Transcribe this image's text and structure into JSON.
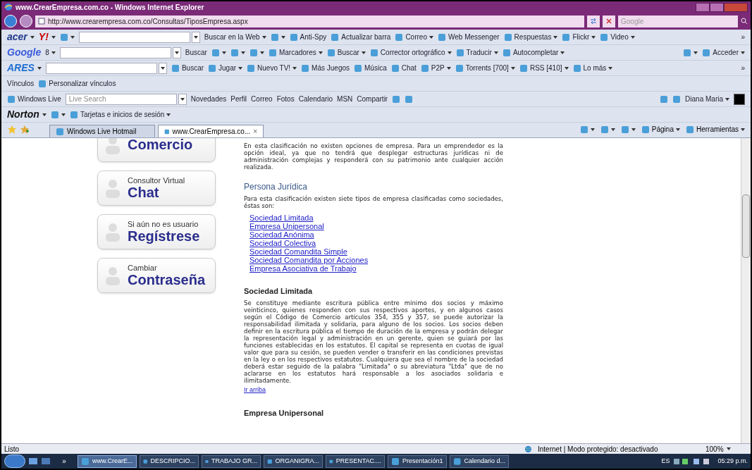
{
  "window": {
    "title": "www.CrearEmpresa.com.co - Windows Internet Explorer"
  },
  "address_bar": {
    "url": "http://www.crearempresa.com.co/Consultas/TiposEmpresa.aspx"
  },
  "search": {
    "placeholder": "Google"
  },
  "toolbars": [
    {
      "items": [
        {
          "kind": "logo",
          "label": "acer",
          "color": "#1f3a8a",
          "caret": true
        },
        {
          "kind": "logo",
          "label": "Y!",
          "color": "#cc0000",
          "caret": true
        },
        {
          "kind": "button",
          "icon": true,
          "caret": true
        },
        {
          "kind": "field",
          "caret": true
        },
        {
          "kind": "button",
          "label": "Buscar en la Web",
          "caret": true
        },
        {
          "kind": "button",
          "icon": true,
          "caret": true
        },
        {
          "kind": "button",
          "label": "Anti-Spy",
          "icon": true,
          "caret": false
        },
        {
          "kind": "button",
          "label": "Actualizar barra",
          "icon": true,
          "caret": false
        },
        {
          "kind": "button",
          "label": "Correo",
          "icon": true,
          "caret": true
        },
        {
          "kind": "button",
          "label": "Web Messenger",
          "icon": true,
          "caret": false
        },
        {
          "kind": "button",
          "label": "Respuestas",
          "icon": true,
          "caret": true
        },
        {
          "kind": "button",
          "label": "Flickr",
          "icon": true,
          "caret": true
        },
        {
          "kind": "button",
          "label": "Video",
          "icon": true,
          "caret": true
        },
        {
          "kind": "spacer"
        },
        {
          "kind": "more",
          "label": "»"
        }
      ]
    },
    {
      "items": [
        {
          "kind": "logo",
          "label": "Google",
          "color": "#3b5bdb",
          "caret": false
        },
        {
          "kind": "button",
          "label": "8",
          "caret": true
        },
        {
          "kind": "field",
          "caret": true
        },
        {
          "kind": "button",
          "label": "Buscar",
          "caret": false
        },
        {
          "kind": "button",
          "icon": true,
          "caret": true
        },
        {
          "kind": "button",
          "icon": true,
          "caret": true
        },
        {
          "kind": "button",
          "icon": true,
          "caret": true
        },
        {
          "kind": "button",
          "label": "Marcadores",
          "icon": true,
          "caret": true
        },
        {
          "kind": "button",
          "label": "Buscar",
          "icon": true,
          "caret": true
        },
        {
          "kind": "button",
          "label": "Corrector ortográfico",
          "icon": true,
          "caret": true
        },
        {
          "kind": "button",
          "label": "Traducir",
          "icon": true,
          "caret": true
        },
        {
          "kind": "button",
          "label": "Autocompletar",
          "icon": true,
          "caret": true
        },
        {
          "kind": "spacer"
        },
        {
          "kind": "button",
          "icon": true,
          "caret": true
        },
        {
          "kind": "button",
          "label": "Acceder",
          "icon": true,
          "caret": true
        }
      ]
    },
    {
      "items": [
        {
          "kind": "logo",
          "label": "ARES",
          "color": "#1f6fd1",
          "caret": true
        },
        {
          "kind": "field",
          "caret": true
        },
        {
          "kind": "button",
          "label": "Buscar",
          "icon": true,
          "caret": false
        },
        {
          "kind": "button",
          "label": "Jugar",
          "icon": true,
          "caret": true
        },
        {
          "kind": "button",
          "label": "Nuevo TV!",
          "icon": true,
          "caret": true
        },
        {
          "kind": "button",
          "label": "Más Juegos",
          "icon": true,
          "caret": false
        },
        {
          "kind": "button",
          "label": "Música",
          "icon": true,
          "caret": false
        },
        {
          "kind": "button",
          "label": "Chat",
          "icon": true,
          "caret": false
        },
        {
          "kind": "button",
          "label": "P2P",
          "icon": true,
          "caret": true
        },
        {
          "kind": "button",
          "label": "Torrents [700]",
          "icon": true,
          "caret": true
        },
        {
          "kind": "button",
          "label": "RSS [410]",
          "icon": true,
          "caret": true
        },
        {
          "kind": "button",
          "label": "Lo más",
          "icon": true,
          "caret": true
        },
        {
          "kind": "spacer"
        },
        {
          "kind": "more",
          "label": "»"
        }
      ]
    },
    {
      "items": [
        {
          "kind": "button",
          "label": "Vínculos",
          "caret": false
        },
        {
          "kind": "button",
          "label": "Personalizar vínculos",
          "icon": true,
          "caret": false
        }
      ]
    },
    {
      "items": [
        {
          "kind": "button",
          "label": "Windows Live",
          "icon": true,
          "caret": false
        },
        {
          "kind": "field",
          "placeholder": "Live Search",
          "caret": true
        },
        {
          "kind": "button",
          "label": "Novedades",
          "caret": false
        },
        {
          "kind": "button",
          "label": "Perfil",
          "caret": false
        },
        {
          "kind": "button",
          "label": "Correo",
          "caret": false
        },
        {
          "kind": "button",
          "label": "Fotos",
          "caret": false
        },
        {
          "kind": "button",
          "label": "Calendario",
          "caret": false
        },
        {
          "kind": "button",
          "label": "MSN",
          "caret": false
        },
        {
          "kind": "button",
          "label": "Compartir",
          "caret": false
        },
        {
          "kind": "button",
          "icon": true,
          "caret": false
        },
        {
          "kind": "button",
          "icon": true,
          "caret": false
        },
        {
          "kind": "spacer"
        },
        {
          "kind": "button",
          "icon": true,
          "caret": false
        },
        {
          "kind": "button",
          "icon": true,
          "caret": false
        },
        {
          "kind": "button",
          "label": "Diana Maria",
          "caret": true
        },
        {
          "kind": "swatch",
          "color": "#000000"
        }
      ]
    },
    {
      "items": [
        {
          "kind": "logo",
          "label": "Norton",
          "color": "#111111",
          "caret": true
        },
        {
          "kind": "button",
          "icon": true,
          "caret": true
        },
        {
          "kind": "button",
          "label": "Tarjetas e inicios de sesión",
          "icon": true,
          "caret": true
        }
      ]
    }
  ],
  "tabs": [
    {
      "label": "Windows Live Hotmail",
      "selected": false
    },
    {
      "label": "www.CrearEmpresa.co...",
      "selected": true,
      "close": "×"
    }
  ],
  "command_bar": [
    {
      "icon": true
    },
    {
      "icon": true
    },
    {
      "icon": true
    },
    {
      "label": "Página",
      "icon": true
    },
    {
      "label": "Herramientas",
      "icon": true
    }
  ],
  "sidebar": {
    "items": [
      {
        "big": "Comercio"
      },
      {
        "small": "Consultor Virtual",
        "big": "Chat"
      },
      {
        "small": "Si aún no es usuario",
        "big": "Regístrese"
      },
      {
        "small": "Cambiar",
        "big": "Contraseña"
      }
    ]
  },
  "content": [
    {
      "kind": "paragraph",
      "text": "En esta clasificación no existen opciones de empresa. Para un emprendedor es la opción ideal, ya que no tendrá que desplegar estructuras jurídicas ni de administración complejas y responderá con su patrimonio ante cualquier acción realizada."
    },
    {
      "kind": "subheading",
      "text": "Persona Jurídica"
    },
    {
      "kind": "paragraph",
      "text": "Para esta clasificación existen siete tipos de empresa clasificadas como sociedades, éstas son:"
    },
    {
      "kind": "links",
      "items": [
        "Sociedad Limitada",
        "Empresa Unipersonal",
        "Sociedad Anónima",
        "Sociedad Colectiva",
        "Sociedad Comandita Simple",
        "Sociedad Comandita por Acciones",
        "Empresa Asociativa de Trabajo"
      ]
    },
    {
      "kind": "heading",
      "text": "Sociedad Limitada"
    },
    {
      "kind": "paragraph",
      "text": "Se constituye mediante escritura pública entre mínimo dos socios y máximo veinticinco, quienes responden con sus respectivos aportes, y en algunos casos según el Código de Comercio artículos 354, 355 y 357, se puede autorizar la responsabilidad ilimitada y solidaria, para alguno de los socios. Los socios deben definir en la escritura pública el tiempo de duración de la empresa y podrán delegar la representación legal y administración en un gerente, quien se guiará por las funciones establecidas en los estatutos. El capital se representa en cuotas de igual valor que para su cesión, se pueden vender o transferir en las condiciones previstas en la ley o en los respectivos estatutos. Cualquiera que sea el nombre de la sociedad deberá estar seguido de la palabra \"Limitada\" o su abreviatura \"Ltda\" que de no aclararse en los estatutos hará responsable a los asociados solidaria e ilimitadamente."
    },
    {
      "kind": "toplink",
      "text": "Ir arriba"
    },
    {
      "kind": "heading",
      "text": "Empresa Unipersonal"
    }
  ],
  "status_bar": {
    "text": "Listo",
    "zone": "Internet | Modo protegido: desactivado",
    "zoom": "100%"
  },
  "taskbar": {
    "more": "»",
    "items": [
      {
        "label": "www.CrearE...",
        "selected": true
      },
      {
        "label": "DESCRIPCIO...",
        "selected": false
      },
      {
        "label": "TRABAJO GR...",
        "selected": false
      },
      {
        "label": "ORGANIGRA...",
        "selected": false
      },
      {
        "label": "PRESENTAC....",
        "selected": false
      },
      {
        "label": "Presentación1",
        "selected": false
      },
      {
        "label": "Calendario d...",
        "selected": false
      }
    ],
    "language": "ES",
    "clock": "05:29 p.m."
  }
}
